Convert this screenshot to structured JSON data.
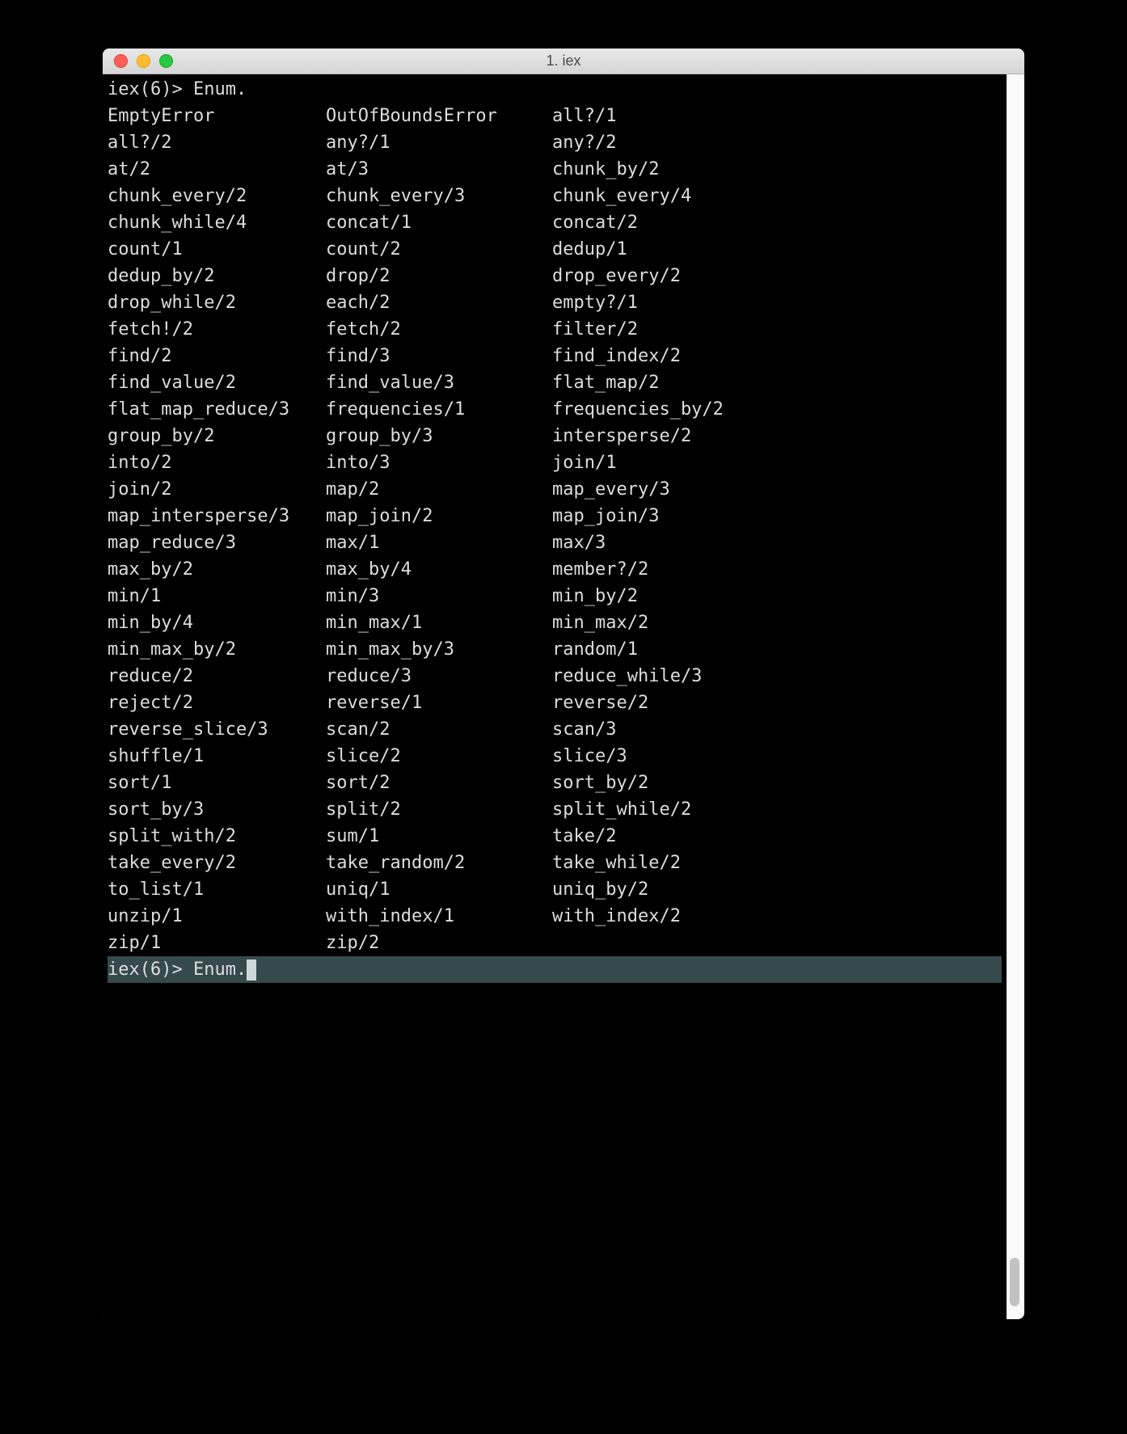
{
  "window": {
    "title": "1. iex"
  },
  "prompt": {
    "first_line": "iex(6)> Enum.",
    "input_line": "iex(6)> Enum."
  },
  "completions": [
    "EmptyError",
    "OutOfBoundsError",
    "all?/1",
    "all?/2",
    "any?/1",
    "any?/2",
    "at/2",
    "at/3",
    "chunk_by/2",
    "chunk_every/2",
    "chunk_every/3",
    "chunk_every/4",
    "chunk_while/4",
    "concat/1",
    "concat/2",
    "count/1",
    "count/2",
    "dedup/1",
    "dedup_by/2",
    "drop/2",
    "drop_every/2",
    "drop_while/2",
    "each/2",
    "empty?/1",
    "fetch!/2",
    "fetch/2",
    "filter/2",
    "find/2",
    "find/3",
    "find_index/2",
    "find_value/2",
    "find_value/3",
    "flat_map/2",
    "flat_map_reduce/3",
    "frequencies/1",
    "frequencies_by/2",
    "group_by/2",
    "group_by/3",
    "intersperse/2",
    "into/2",
    "into/3",
    "join/1",
    "join/2",
    "map/2",
    "map_every/3",
    "map_intersperse/3",
    "map_join/2",
    "map_join/3",
    "map_reduce/3",
    "max/1",
    "max/3",
    "max_by/2",
    "max_by/4",
    "member?/2",
    "min/1",
    "min/3",
    "min_by/2",
    "min_by/4",
    "min_max/1",
    "min_max/2",
    "min_max_by/2",
    "min_max_by/3",
    "random/1",
    "reduce/2",
    "reduce/3",
    "reduce_while/3",
    "reject/2",
    "reverse/1",
    "reverse/2",
    "reverse_slice/3",
    "scan/2",
    "scan/3",
    "shuffle/1",
    "slice/2",
    "slice/3",
    "sort/1",
    "sort/2",
    "sort_by/2",
    "sort_by/3",
    "split/2",
    "split_while/2",
    "split_with/2",
    "sum/1",
    "take/2",
    "take_every/2",
    "take_random/2",
    "take_while/2",
    "to_list/1",
    "uniq/1",
    "uniq_by/2",
    "unzip/1",
    "with_index/1",
    "with_index/2",
    "zip/1",
    "zip/2"
  ]
}
